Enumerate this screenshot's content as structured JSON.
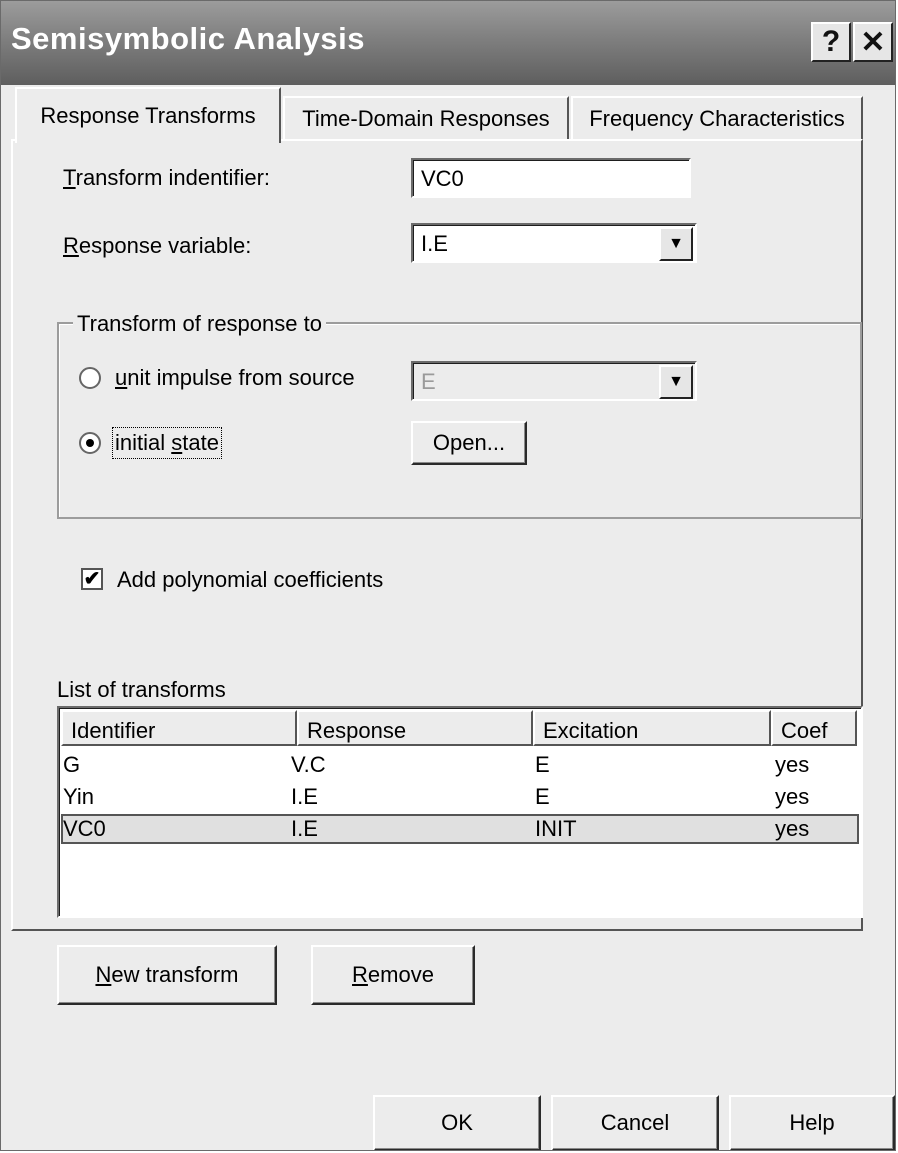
{
  "window": {
    "title": "Semisymbolic Analysis",
    "help_glyph": "?",
    "close_glyph": "✕"
  },
  "tabs": [
    {
      "label": "Response Transforms",
      "active": true
    },
    {
      "label": "Time-Domain Responses",
      "active": false
    },
    {
      "label": "Frequency Characteristics",
      "active": false
    }
  ],
  "form": {
    "transform_identifier": {
      "label_key": "T",
      "label_rest": "ransform indentifier:",
      "value": "VC0"
    },
    "response_variable": {
      "label_key": "R",
      "label_rest": "esponse variable:",
      "value": "I.E"
    }
  },
  "group": {
    "title": "Transform of response to",
    "option_impulse": {
      "key": "u",
      "rest": "nit impulse from source",
      "selected": false,
      "source_value": "E"
    },
    "option_initial": {
      "pre": "initial ",
      "key": "s",
      "rest": "tate",
      "selected": true
    },
    "open_button": "Open..."
  },
  "checkbox": {
    "label": "Add polynomial coefficients",
    "checked": true,
    "mark": "✔"
  },
  "list": {
    "title": "List of transforms",
    "columns": [
      "Identifier",
      "Response",
      "Excitation",
      "Coef"
    ],
    "rows": [
      {
        "id": "G",
        "response": "V.C",
        "excitation": "E",
        "coef": "yes"
      },
      {
        "id": "Yin",
        "response": "I.E",
        "excitation": "E",
        "coef": "yes"
      },
      {
        "id": "VC0",
        "response": "I.E",
        "excitation": "INIT",
        "coef": "yes",
        "selected": true
      }
    ]
  },
  "buttons": {
    "new_key": "N",
    "new_rest": "ew transform",
    "remove_key": "R",
    "remove_rest": "emove",
    "ok": "OK",
    "cancel": "Cancel",
    "help": "Help"
  },
  "icons": {
    "dropdown_arrow": "▼"
  }
}
